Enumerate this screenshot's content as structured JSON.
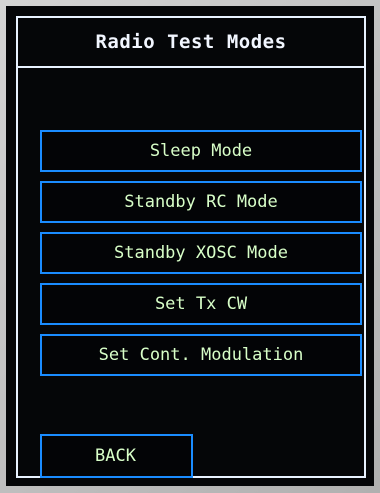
{
  "screen": {
    "title": "Radio Test Modes"
  },
  "menu": {
    "items": [
      {
        "label": "Sleep Mode"
      },
      {
        "label": "Standby RC Mode"
      },
      {
        "label": "Standby XOSC Mode"
      },
      {
        "label": "Set Tx CW"
      },
      {
        "label": "Set Cont. Modulation"
      }
    ]
  },
  "footer": {
    "back_label": "BACK"
  },
  "colors": {
    "background": "#050608",
    "frame": "#e8f2ff",
    "button_border": "#1a8cff",
    "button_text": "#d8ffc8"
  }
}
